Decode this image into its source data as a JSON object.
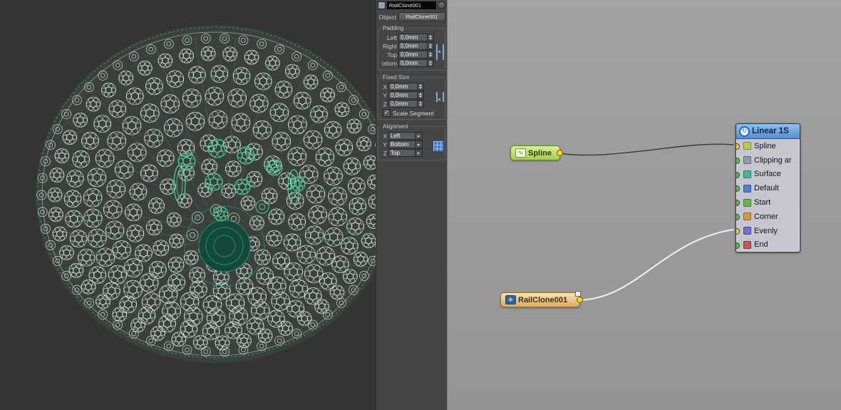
{
  "panel": {
    "stack_name": "RailClone001",
    "object_label": "Object",
    "object_value": "RailClone001",
    "padding": {
      "title": "Padding",
      "rows": [
        {
          "label": "Left",
          "value": "0,0mm"
        },
        {
          "label": "Right",
          "value": "0,0mm"
        },
        {
          "label": "Top",
          "value": "0,0mm"
        },
        {
          "label": "ottom",
          "value": "0,0mm"
        }
      ]
    },
    "fixed_size": {
      "title": "Fixed Size",
      "rows": [
        {
          "label": "X",
          "value": "0,0mm"
        },
        {
          "label": "Y",
          "value": "0,0mm"
        },
        {
          "label": "Z",
          "value": "0,0mm"
        }
      ],
      "checkbox_label": "Scale Segment",
      "check_glyph": "✓"
    },
    "alignment": {
      "title": "Alignment",
      "rows": [
        {
          "label": "X",
          "value": "Left"
        },
        {
          "label": "Y",
          "value": "Bottom"
        },
        {
          "label": "Z",
          "value": "Top"
        }
      ]
    }
  },
  "nodes": {
    "spline": {
      "label": "Spline"
    },
    "railclone": {
      "label": "RailClone001"
    },
    "linear": {
      "title": "Linear 1S",
      "slots": [
        {
          "label": "Spline",
          "dot": "#ffd21e",
          "icon": "#b5cf4d"
        },
        {
          "label": "Clipping ar",
          "dot": "#49c749",
          "icon": "#8f9bb0"
        },
        {
          "label": "Surface",
          "dot": "#49c749",
          "icon": "#49b4a0"
        },
        {
          "label": "Default",
          "dot": "#49c749",
          "icon": "#4f7fd6"
        },
        {
          "label": "Start",
          "dot": "#49c749",
          "icon": "#67b84e"
        },
        {
          "label": "Corner",
          "dot": "#49c749",
          "icon": "#d39a45"
        },
        {
          "label": "Evenly",
          "dot": "#ffd21e",
          "icon": "#7a6cd6"
        },
        {
          "label": "End",
          "dot": "#49c749",
          "icon": "#c65757"
        }
      ]
    }
  },
  "icons": {
    "spline_glyph": "∿",
    "railclone_glyph": "❖",
    "linear_glyph": "↻"
  },
  "colors": {
    "viewport_bg": "#353535",
    "panel_bg": "#454545",
    "editor_bg": "#a3a3a3",
    "linear_header": "#8ec0ee",
    "port_yellow": "#ffd21e",
    "port_green": "#49c749",
    "wire_dark": "#3a3a3a",
    "wire_light": "#f2f2f2",
    "wireframe_white": "#e9f2ec",
    "selection_green": "#4fd8a0"
  }
}
